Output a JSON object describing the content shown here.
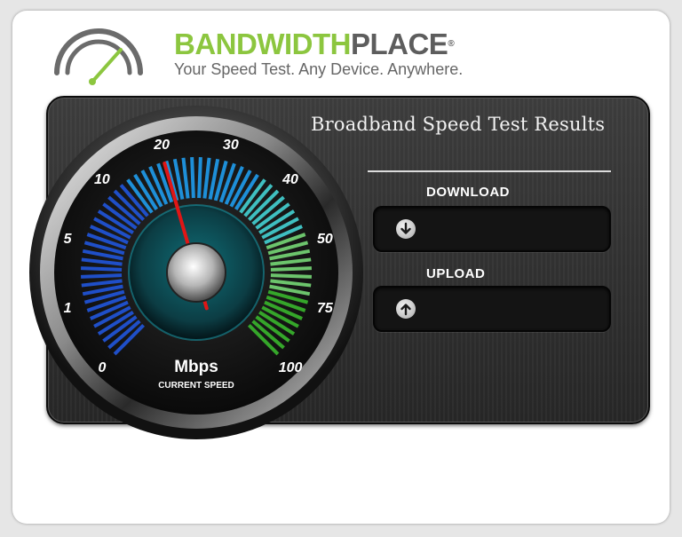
{
  "brand": {
    "part1": "BANDWIDTH",
    "part2": "PLACE",
    "reg": "®"
  },
  "tagline": "Your Speed Test. Any Device. Anywhere.",
  "panel": {
    "title": "Broadband Speed Test Results",
    "download_label": "DOWNLOAD",
    "upload_label": "UPLOAD",
    "download_value": "",
    "upload_value": ""
  },
  "gauge": {
    "unit": "Mbps",
    "caption": "CURRENT SPEED",
    "scale_labels": [
      "0",
      "1",
      "5",
      "10",
      "20",
      "30",
      "40",
      "50",
      "75",
      "100"
    ],
    "needle_position": 0.44
  },
  "colors": {
    "brand_green": "#8cc63f",
    "brand_gray": "#5d5d5d",
    "needle": "#e01616"
  },
  "icons": {
    "download": "arrow-down-icon",
    "upload": "arrow-up-icon",
    "logo": "speedometer-logo-icon"
  }
}
